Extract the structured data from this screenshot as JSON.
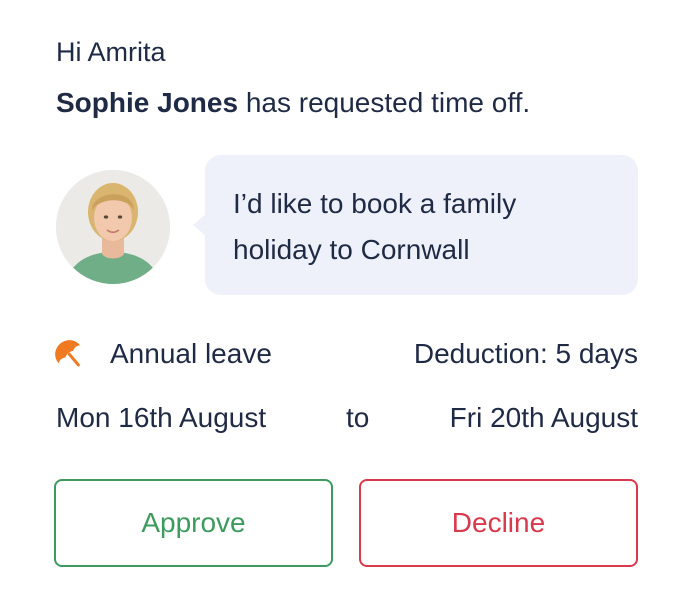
{
  "greeting": "Hi Amrita",
  "request": {
    "requester_name": "Sophie Jones",
    "message": "has requested time off."
  },
  "comment": {
    "text": "I’d like to book a family holiday to Cornwall",
    "avatar": "user-avatar-photo"
  },
  "leave": {
    "icon": "umbrella-icon",
    "icon_color": "#f07a22",
    "type": "Annual leave",
    "deduction": "Deduction: 5 days"
  },
  "dates": {
    "start": "Mon 16th August",
    "separator": "to",
    "end": "Fri 20th August"
  },
  "actions": {
    "approve_label": "Approve",
    "decline_label": "Decline",
    "approve_color": "#3e9a5f",
    "decline_color": "#d8394c"
  },
  "colors": {
    "text": "#1f2a44",
    "bubble_bg": "#eef1fa"
  }
}
